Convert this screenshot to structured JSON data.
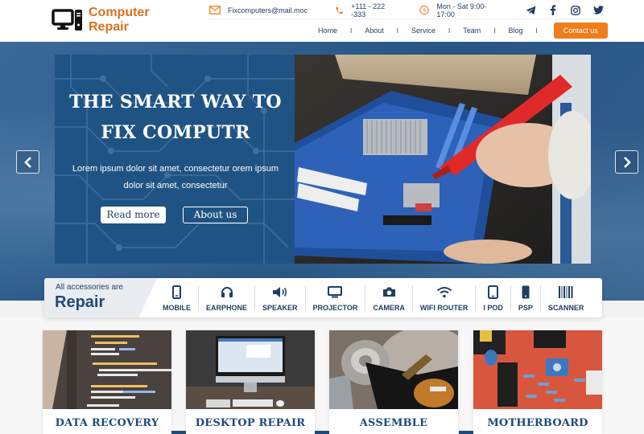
{
  "brand": {
    "name_line1": "Computer",
    "name_line2": "Repair",
    "accent_color": "#d9701c",
    "primary_color": "#1f4a78"
  },
  "topbar": {
    "email": "Fixcomputers@mail.moc",
    "phone": "+111 - 222 -333",
    "hours": "Mon - Sat 9:00-17:00",
    "social": [
      "telegram-icon",
      "facebook-icon",
      "instagram-icon",
      "twitter-icon"
    ]
  },
  "nav": {
    "items": [
      {
        "label": "Home"
      },
      {
        "label": "About"
      },
      {
        "label": "Service"
      },
      {
        "label": "Team"
      },
      {
        "label": "Blog"
      }
    ],
    "separator": "I",
    "contact_label": "Contact us"
  },
  "hero": {
    "title_line1": "THE SMART WAY TO",
    "title_line2": "FIX COMPUTR",
    "text": "Lorem ipsum dolor sit amet, consectetur orem ipsum dolor sit amet, consectetur",
    "read_more_label": "Read more",
    "about_label": "About us",
    "photo": "technician-testing-motherboard"
  },
  "accessories": {
    "intro": "All accessories are",
    "heading": "Repair",
    "items": [
      {
        "label": "MOBILE",
        "icon": "mobile-icon"
      },
      {
        "label": "EARPHONE",
        "icon": "headphones-icon"
      },
      {
        "label": "SPEAKER",
        "icon": "speaker-icon"
      },
      {
        "label": "PROJECTOR",
        "icon": "monitor-icon"
      },
      {
        "label": "CAMERA",
        "icon": "camera-icon"
      },
      {
        "label": "WIFI ROUTER",
        "icon": "wifi-icon"
      },
      {
        "label": "I POD",
        "icon": "tablet-icon"
      },
      {
        "label": "PSP",
        "icon": "phone-icon"
      },
      {
        "label": "SCANNER",
        "icon": "barcode-icon"
      }
    ]
  },
  "services": [
    {
      "title": "DATA RECOVERY",
      "image": "code-on-screen"
    },
    {
      "title": "DESKTOP REPAIR",
      "image": "desktop-computer"
    },
    {
      "title": "ASSEMBLE",
      "image": "hard-drive-internals"
    },
    {
      "title": "MOTHERBOARD",
      "image": "circuit-board"
    }
  ]
}
